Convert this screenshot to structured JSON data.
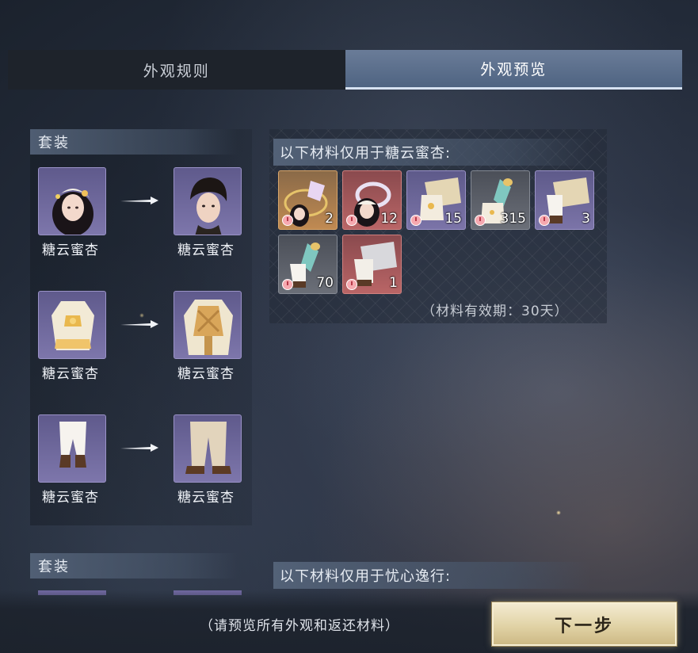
{
  "tabs": [
    {
      "label": "外观规则",
      "active": false
    },
    {
      "label": "外观预览",
      "active": true
    }
  ],
  "sets": [
    {
      "header": "套装",
      "pairs": [
        {
          "from_name": "糖云蜜杏",
          "from_icon": "female-head-hat-icon",
          "to_name": "糖云蜜杏",
          "to_icon": "male-head-hair-icon"
        },
        {
          "from_name": "糖云蜜杏",
          "from_icon": "female-top-outfit-icon",
          "to_name": "糖云蜜杏",
          "to_icon": "male-top-outfit-icon"
        },
        {
          "from_name": "糖云蜜杏",
          "from_icon": "female-pants-boots-icon",
          "to_name": "糖云蜜杏",
          "to_icon": "male-pants-boots-icon"
        }
      ]
    },
    {
      "header": "套装"
    }
  ],
  "material_groups": [
    {
      "header": "以下材料仅用于糖云蜜杏:",
      "items": [
        {
          "icon": "hair-accessory-material-icon",
          "count": "2",
          "rarity": "orange"
        },
        {
          "icon": "hair-set-material-icon",
          "count": "12",
          "rarity": "red"
        },
        {
          "icon": "cloth-bolt-material-icon",
          "count": "15",
          "rarity": "purple"
        },
        {
          "icon": "thread-spool-material-icon",
          "count": "315",
          "rarity": "gray"
        },
        {
          "icon": "cloth-bolt-material-icon",
          "count": "3",
          "rarity": "purple"
        },
        {
          "icon": "thread-spool-material-icon",
          "count": "70",
          "rarity": "gray"
        },
        {
          "icon": "cloth-bolt-material-icon",
          "count": "1",
          "rarity": "red"
        }
      ],
      "validity": "（材料有效期：30天）"
    },
    {
      "header": "以下材料仅用于忧心逸行:"
    }
  ],
  "footer": {
    "hint": "（请预览所有外观和返还材料）",
    "next_button": "下一步"
  },
  "colors": {
    "active_tab": "#4f6482",
    "slot_purple": "#7b74a8",
    "slot_orange": "#c08a52",
    "slot_red": "#b96566",
    "button_gold": "#e1d3a6"
  }
}
